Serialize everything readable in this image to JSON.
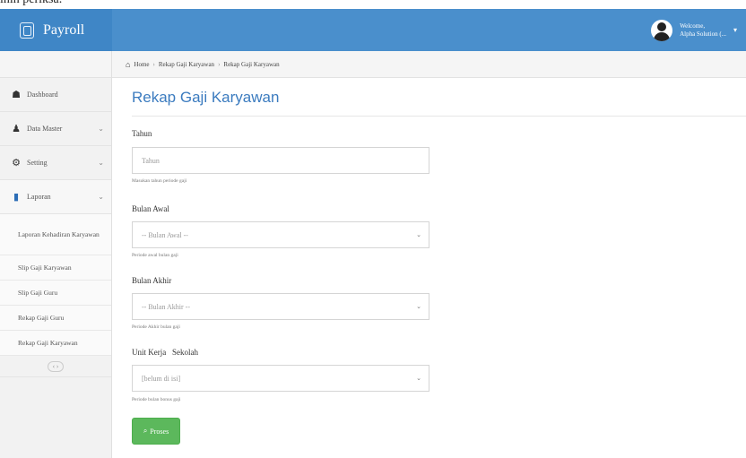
{
  "caption_fragment": "inin periksa.",
  "header": {
    "brand": "Payroll",
    "user_line1": "Welcome,",
    "user_line2": "Alpha Solution (..."
  },
  "sidebar": {
    "items": [
      {
        "label": "Dashboard",
        "icon": "dashboard-icon"
      },
      {
        "label": "Data Master",
        "icon": "user-icon"
      },
      {
        "label": "Setting",
        "icon": "gear-icon"
      },
      {
        "label": "Laporan",
        "icon": "book-icon"
      }
    ],
    "sub_items": [
      "Laporan Kehadiran Karyawan",
      "Slip Gaji Karyawan",
      "Slip Gaji Guru",
      "Rekap Gaji Guru",
      "Rekap Gaji Karyawan"
    ],
    "collapse_symbol": "‹ ›"
  },
  "breadcrumb": {
    "home": "Home",
    "level1": "Rekap Gaji Karyawan",
    "level2": "Rekap Gaji Karyawan"
  },
  "main": {
    "title": "Rekap Gaji Karyawan",
    "fields": {
      "tahun": {
        "label": "Tahun",
        "placeholder": "Tahun",
        "help": "Masukan tahun periode gaji"
      },
      "bulan_awal": {
        "label": "Bulan Awal",
        "value": "-- Bulan Awal --",
        "help": "Periode awal bulan gaji"
      },
      "bulan_akhir": {
        "label": "Bulan Akhir",
        "value": "-- Bulan Akhir --",
        "help": "Periode Akhir bulan gaji"
      },
      "unit_kerja": {
        "label": "Unit Kerja   Sekolah",
        "value": "[belum di isi]",
        "help": "Periode bulan bonus gaji"
      }
    },
    "submit_label": "Proses",
    "submit_icon": "search-icon"
  }
}
